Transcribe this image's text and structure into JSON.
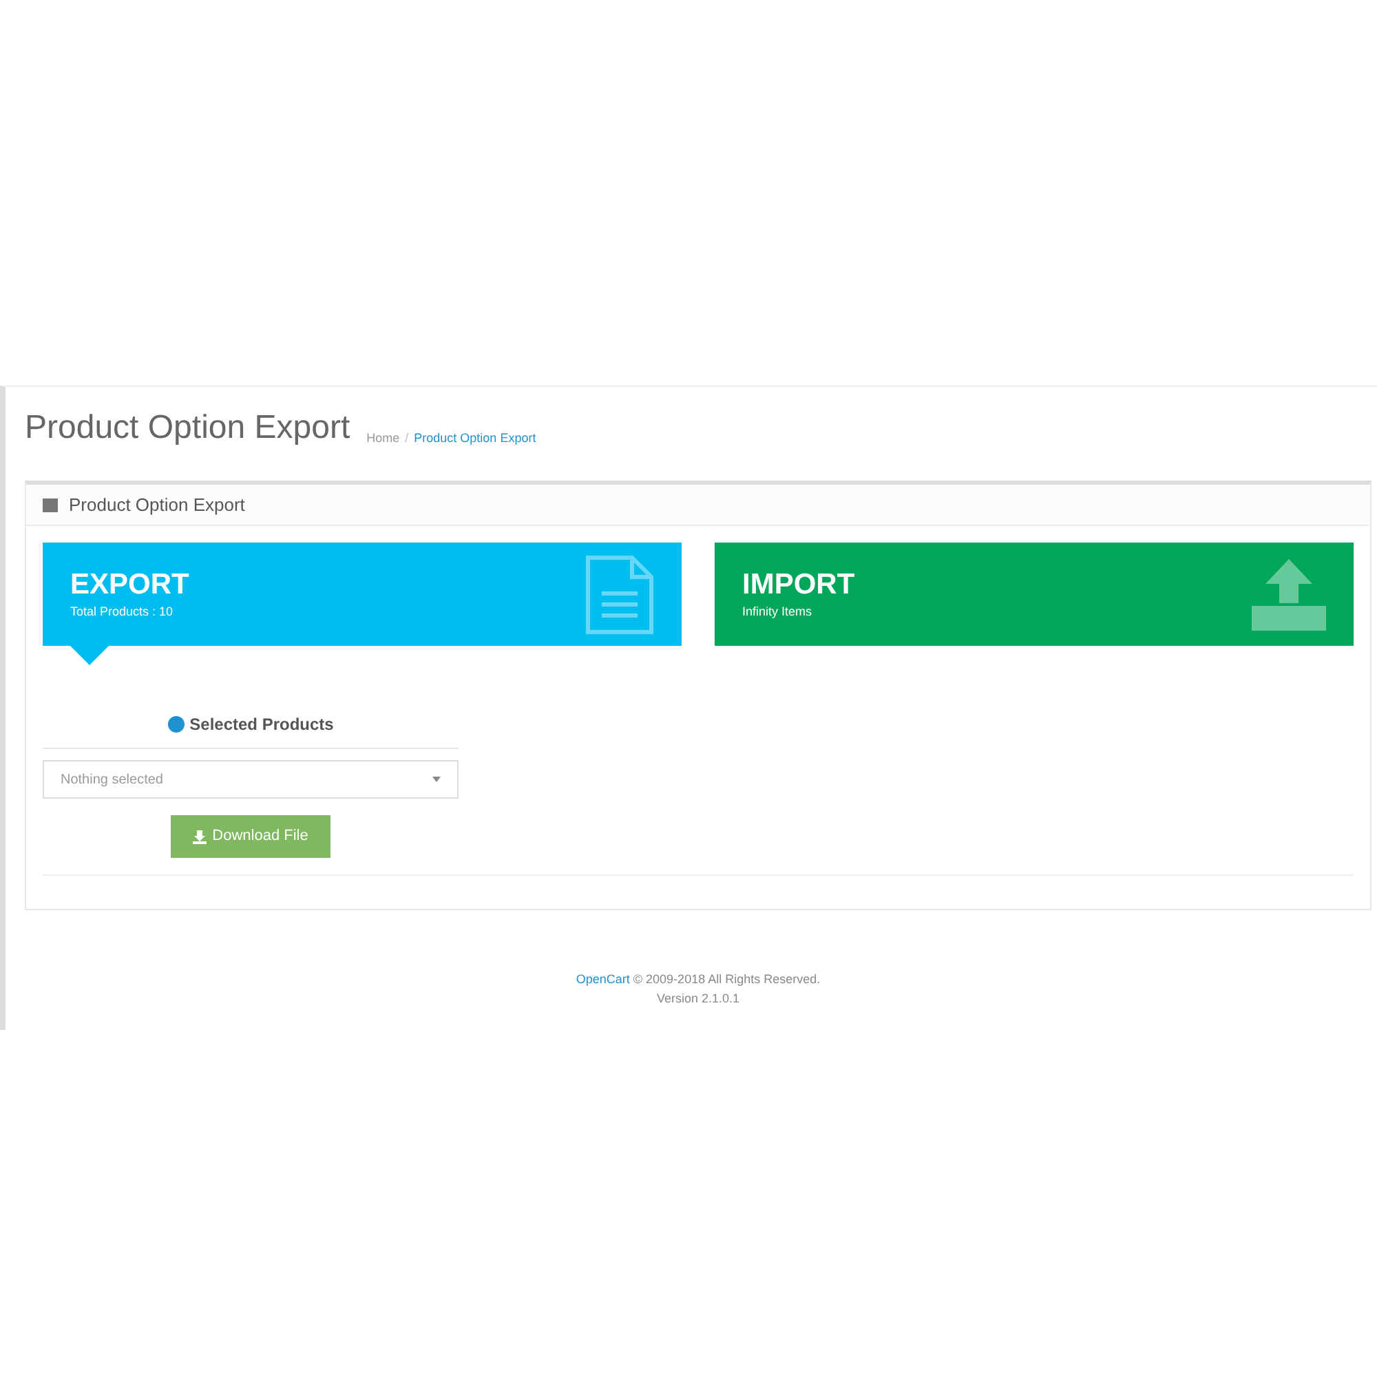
{
  "page": {
    "title": "Product Option Export",
    "breadcrumb_separator": "/",
    "breadcrumb": [
      {
        "label": "Home",
        "current": false
      },
      {
        "label": "Product Option Export",
        "current": true
      }
    ]
  },
  "panel": {
    "title": "Product Option Export",
    "tiles": [
      {
        "kind": "export",
        "title": "EXPORT",
        "subtitle": "Total Products : 10",
        "selected": true,
        "color": "#00bdf0"
      },
      {
        "kind": "import",
        "title": "IMPORT",
        "subtitle": "Infinity Items",
        "selected": false,
        "color": "#00a65a"
      }
    ],
    "form": {
      "label": "Selected Products",
      "select": {
        "placeholder": "Nothing selected"
      },
      "button": "Download File"
    }
  },
  "footer": {
    "link": "OpenCart",
    "text": " © 2009-2018 All Rights Reserved.",
    "version": "Version 2.1.0.1"
  }
}
